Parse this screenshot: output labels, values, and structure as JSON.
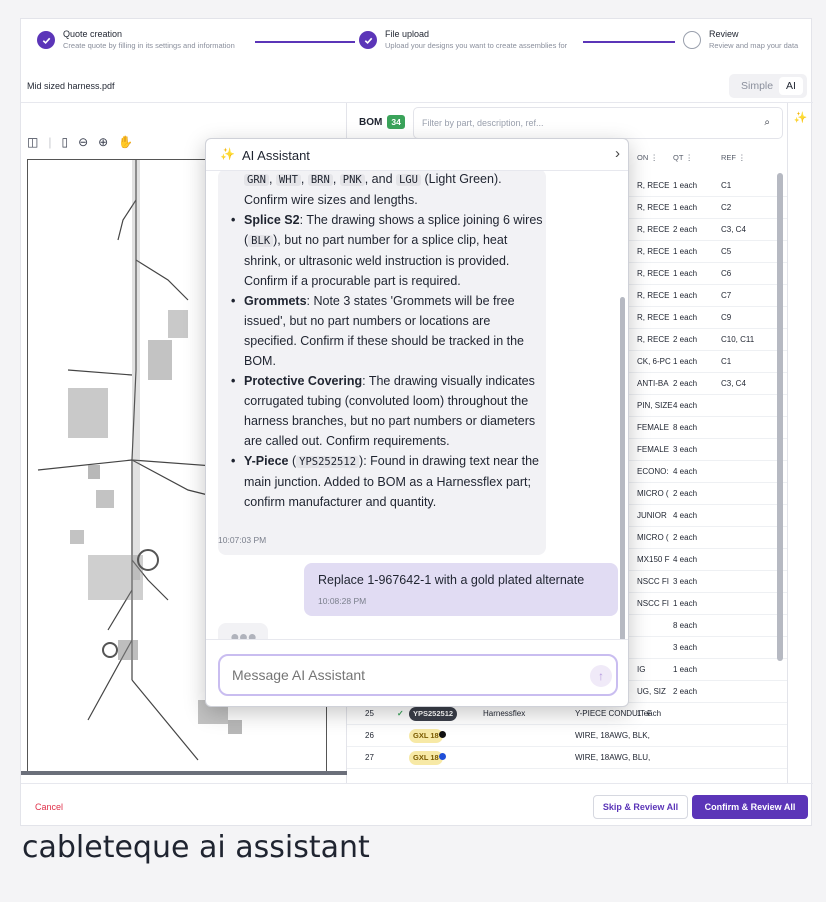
{
  "stepper": {
    "steps": [
      {
        "title": "Quote creation",
        "subtitle": "Create quote by filling in its settings and information",
        "state": "done"
      },
      {
        "title": "File upload",
        "subtitle": "Upload your designs you want to create assemblies for",
        "state": "done"
      },
      {
        "title": "Review",
        "subtitle": "Review and map your data",
        "state": "pending"
      }
    ]
  },
  "file": {
    "name": "Mid sized harness.pdf"
  },
  "mode_toggle": {
    "simple": "Simple",
    "ai": "AI",
    "active": "AI"
  },
  "bom": {
    "label": "BOM",
    "count": "34",
    "filter_placeholder": "Filter by part, description, ref...",
    "columns": {
      "description": "ON",
      "qty": "QT",
      "ref": "REF"
    },
    "rows": [
      {
        "desc": "R, RECE",
        "qty": "1 each",
        "ref": "C1"
      },
      {
        "desc": "R, RECE",
        "qty": "1 each",
        "ref": "C2"
      },
      {
        "desc": "R, RECE",
        "qty": "2 each",
        "ref": "C3, C4"
      },
      {
        "desc": "R, RECE",
        "qty": "1 each",
        "ref": "C5"
      },
      {
        "desc": "R, RECE",
        "qty": "1 each",
        "ref": "C6"
      },
      {
        "desc": "R, RECE",
        "qty": "1 each",
        "ref": "C7"
      },
      {
        "desc": "R, RECE",
        "qty": "1 each",
        "ref": "C9"
      },
      {
        "desc": "R, RECE",
        "qty": "2 each",
        "ref": "C10, C11"
      },
      {
        "desc": "CK, 6-PC",
        "qty": "1 each",
        "ref": "C1"
      },
      {
        "desc": "ANTI-BA",
        "qty": "2 each",
        "ref": "C3, C4"
      },
      {
        "desc": "PIN, SIZE",
        "qty": "4 each",
        "ref": ""
      },
      {
        "desc": "FEMALE",
        "qty": "8 each",
        "ref": ""
      },
      {
        "desc": "FEMALE",
        "qty": "3 each",
        "ref": ""
      },
      {
        "desc": "ECONO:",
        "qty": "4 each",
        "ref": ""
      },
      {
        "desc": "MICRO (",
        "qty": "2 each",
        "ref": ""
      },
      {
        "desc": "JUNIOR",
        "qty": "4 each",
        "ref": ""
      },
      {
        "desc": "MICRO (",
        "qty": "2 each",
        "ref": ""
      },
      {
        "desc": "MX150 F",
        "qty": "4 each",
        "ref": ""
      },
      {
        "desc": "NSCC FI",
        "qty": "3 each",
        "ref": ""
      },
      {
        "desc": "NSCC FI",
        "qty": "1 each",
        "ref": ""
      },
      {
        "desc": "",
        "qty": "8 each",
        "ref": ""
      },
      {
        "desc": "",
        "qty": "3 each",
        "ref": ""
      },
      {
        "desc": "IG",
        "qty": "1 each",
        "ref": ""
      },
      {
        "desc": "UG, SIZ",
        "qty": "2 each",
        "ref": ""
      }
    ],
    "full_rows": [
      {
        "num": "25",
        "part": "YPS252512",
        "manufacturer": "Harnessflex",
        "desc": "Y-PIECE CONDUIT F",
        "qty": "1 each",
        "ref": "",
        "pill_color": "#3b3f4a",
        "pill_text_color": "#ffffff",
        "check": "✓",
        "dot": ""
      },
      {
        "num": "26",
        "part": "GXL 18",
        "manufacturer": "",
        "desc": "WIRE, 18AWG, BLK,",
        "qty": "",
        "ref": "",
        "pill_color": "#f7e9a6",
        "pill_text_color": "#7a5a00",
        "check": "",
        "dot": "#111111"
      },
      {
        "num": "27",
        "part": "GXL 18",
        "manufacturer": "",
        "desc": "WIRE, 18AWG, BLU,",
        "qty": "",
        "ref": "",
        "pill_color": "#f7e9a6",
        "pill_text_color": "#7a5a00",
        "check": "",
        "dot": "#1f4fd8"
      }
    ]
  },
  "assistant": {
    "title": "AI Assistant",
    "intro": {
      "codes": [
        "GRN",
        "WHT",
        "BRN",
        "PNK",
        "LGU"
      ],
      "sep1": ", ",
      "and_text": ", and ",
      "after": " (Light Green). Confirm wire sizes and lengths."
    },
    "items": [
      {
        "label": "Splice S2",
        "pre": ": The drawing shows a splice joining 6 wires (",
        "code": "BLK",
        "post": "), but no part number for a splice clip, heat shrink, or ultrasonic weld instruction is provided. Confirm if a procurable part is required."
      },
      {
        "label": "Grommets",
        "pre": ": Note 3 states 'Grommets will be free issued', but no part numbers or locations are specified. Confirm if these should be tracked in the BOM.",
        "code": "",
        "post": ""
      },
      {
        "label": "Protective Covering",
        "pre": ": The drawing visually indicates corrugated tubing (convoluted loom) throughout the harness branches, but no part numbers or diameters are called out. Confirm requirements.",
        "code": "",
        "post": ""
      },
      {
        "label": "Y-Piece",
        "pre": " (",
        "code": "YPS252512",
        "post": "): Found in drawing text near the main junction. Added to BOM as a Harnessflex part; confirm manufacturer and quantity."
      }
    ],
    "ai_time": "10:07:03 PM",
    "user_message": "Replace 1-967642-1 with a gold plated alternate",
    "user_time": "10:08:28 PM",
    "input_placeholder": "Message AI Assistant"
  },
  "footer": {
    "cancel": "Cancel",
    "skip": "Skip & Review All",
    "confirm": "Confirm & Review All"
  },
  "caption": "cableteque ai assistant",
  "colors": {
    "accent": "#5b35b8",
    "danger": "#e0314a",
    "success": "#3aa35a"
  }
}
